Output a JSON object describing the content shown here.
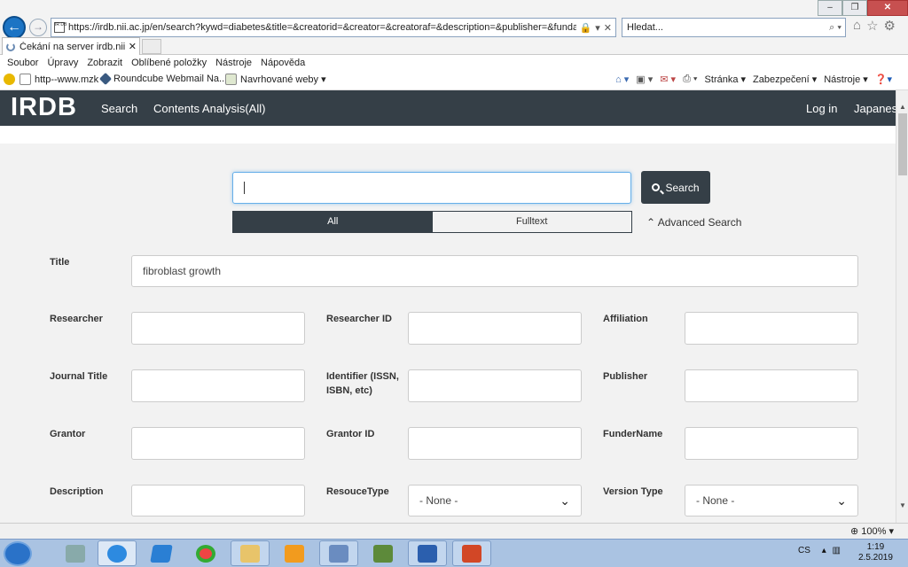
{
  "browser": {
    "url": "https://irdb.nii.ac.jp/en/search?kywd=diabetes&title=&creatorid=&creator=&creatoraf=&description=&publisher=&fundaf=&diaf=&c",
    "search_placeholder": "Hledat...",
    "tab_title": "Čekání na server irdb.nii.ac.jp",
    "menu": [
      "Soubor",
      "Úpravy",
      "Zobrazit",
      "Oblíbené položky",
      "Nástroje",
      "Nápověda"
    ],
    "favorites": [
      "http--www.mzk",
      "Roundcube Webmail Na...",
      "Navrhované weby ▾"
    ],
    "commands": [
      "Stránka ▾",
      "Zabezpečení ▾",
      "Nástroje ▾"
    ],
    "zoom": "100%"
  },
  "site": {
    "logo": "IRDB",
    "nav": [
      "Search",
      "Contents Analysis(All)"
    ],
    "nav_right": [
      "Log in",
      "Japanese"
    ]
  },
  "search": {
    "query": "",
    "button_label": "Search",
    "mode_all": "All",
    "mode_fulltext": "Fulltext",
    "advanced_label": "Advanced Search"
  },
  "form": {
    "title_label": "Title",
    "title_value": "fibroblast growth",
    "rows": [
      [
        {
          "label": "Researcher",
          "value": ""
        },
        {
          "label": "Researcher ID",
          "value": ""
        },
        {
          "label": "Affiliation",
          "value": ""
        }
      ],
      [
        {
          "label": "Journal Title",
          "value": ""
        },
        {
          "label": "Identifier (ISSN, ISBN, etc)",
          "value": ""
        },
        {
          "label": "Publisher",
          "value": ""
        }
      ],
      [
        {
          "label": "Grantor",
          "value": ""
        },
        {
          "label": "Grantor ID",
          "value": ""
        },
        {
          "label": "FunderName",
          "value": ""
        }
      ],
      [
        {
          "label": "Description",
          "value": ""
        },
        {
          "label": "ResouceType",
          "value": "- None -"
        },
        {
          "label": "Version Type",
          "value": "- None -"
        }
      ]
    ]
  },
  "taskbar": {
    "lang": "CS",
    "time": "1:19",
    "date": "2.5.2019"
  },
  "colors": {
    "navbar": "#353f47",
    "focus": "#66afe9"
  }
}
